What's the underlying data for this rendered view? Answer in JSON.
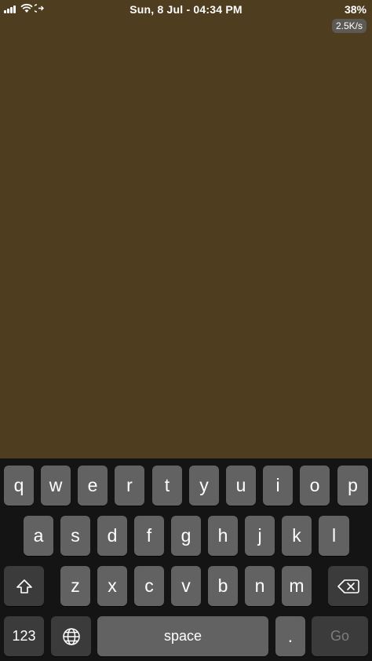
{
  "status_bar": {
    "datetime": "Sun, 8 Jul - 04:34 PM",
    "battery": "38%",
    "network_speed": "2.5K/s",
    "icons": [
      "signal-icon",
      "wifi-icon",
      "call-forward-icon"
    ]
  },
  "colors": {
    "background": "#4f3d20",
    "keyboard": "#141414",
    "key": "#626262",
    "key_dark": "#3b3b3b"
  },
  "keyboard": {
    "row1": [
      "q",
      "w",
      "e",
      "r",
      "t",
      "y",
      "u",
      "i",
      "o",
      "p"
    ],
    "row2": [
      "a",
      "s",
      "d",
      "f",
      "g",
      "h",
      "j",
      "k",
      "l"
    ],
    "row3": [
      "z",
      "x",
      "c",
      "v",
      "b",
      "n",
      "m"
    ],
    "numbers_label": "123",
    "space_label": "space",
    "period_label": ".",
    "go_label": "Go",
    "shift_icon": "shift-icon",
    "delete_icon": "backspace-icon",
    "globe_icon": "globe-icon"
  }
}
